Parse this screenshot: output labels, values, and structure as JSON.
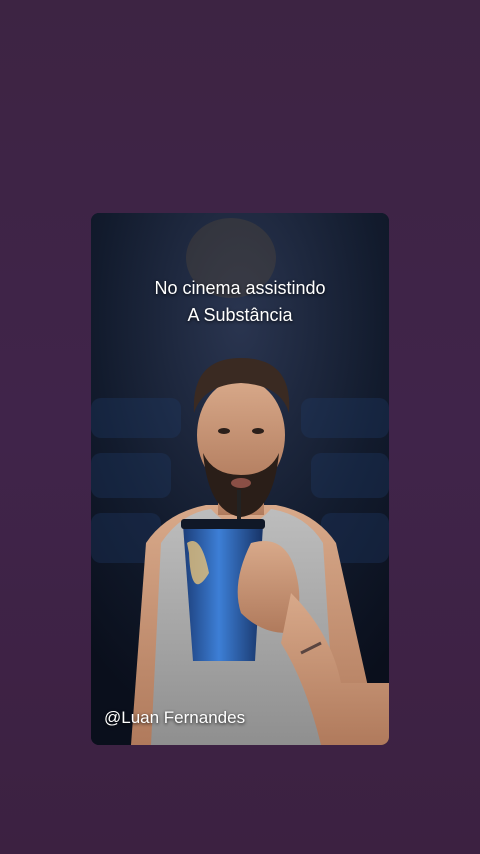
{
  "story": {
    "caption_lines": [
      "No cinema assistindo",
      "A Substância"
    ],
    "watermark_handle": "@Luan Fernandes"
  },
  "colors": {
    "background": "#3f2444",
    "caption_text": "#ffffff"
  }
}
